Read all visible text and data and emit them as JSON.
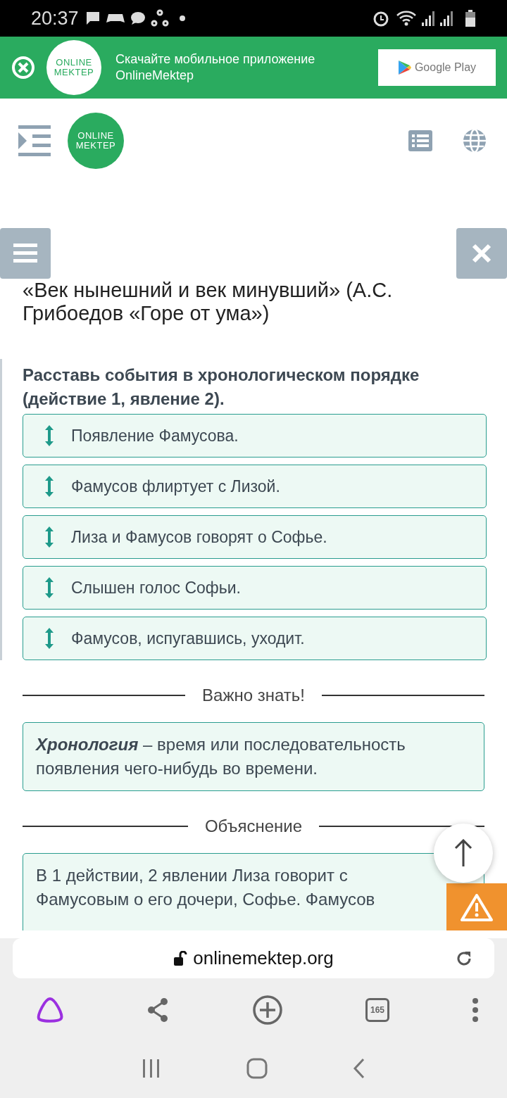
{
  "status_bar": {
    "time": "20:37"
  },
  "app_banner": {
    "logo": [
      "ONLINE",
      "MEKTEP"
    ],
    "text": [
      "Скачайте мобильное приложение",
      "OnlineMektep"
    ],
    "store_button": "Google Play"
  },
  "header": {
    "logo": [
      "ONLINE",
      "MEKTEP"
    ]
  },
  "title": "«Век нынешний и век минувший» (А.С. Грибоедов «Горе от ума»)",
  "task": {
    "question": "Расставь события в хронологическом порядке (действие 1, явление 2).",
    "items": [
      {
        "text": "Появление Фамусова."
      },
      {
        "text": "Фамусов флиртует с Лизой."
      },
      {
        "text": "Лиза и Фамусов говорят о Софье."
      },
      {
        "text": "Слышен голос Софьи."
      },
      {
        "text": "Фамусов, испугавшись, уходит."
      }
    ]
  },
  "important": {
    "heading": "Важно знать!",
    "text": "**Хронология** – время или последовательность появления чего-нибудь во времени."
  },
  "explanation": {
    "heading": "Объяснение",
    "text": "В 1 действии, 2 явлении Лиза говорит с\nФамусовым о его дочери, Софье. Фамусов"
  },
  "browser": {
    "url": "onlinemektep.org",
    "tab_count": "165"
  }
}
